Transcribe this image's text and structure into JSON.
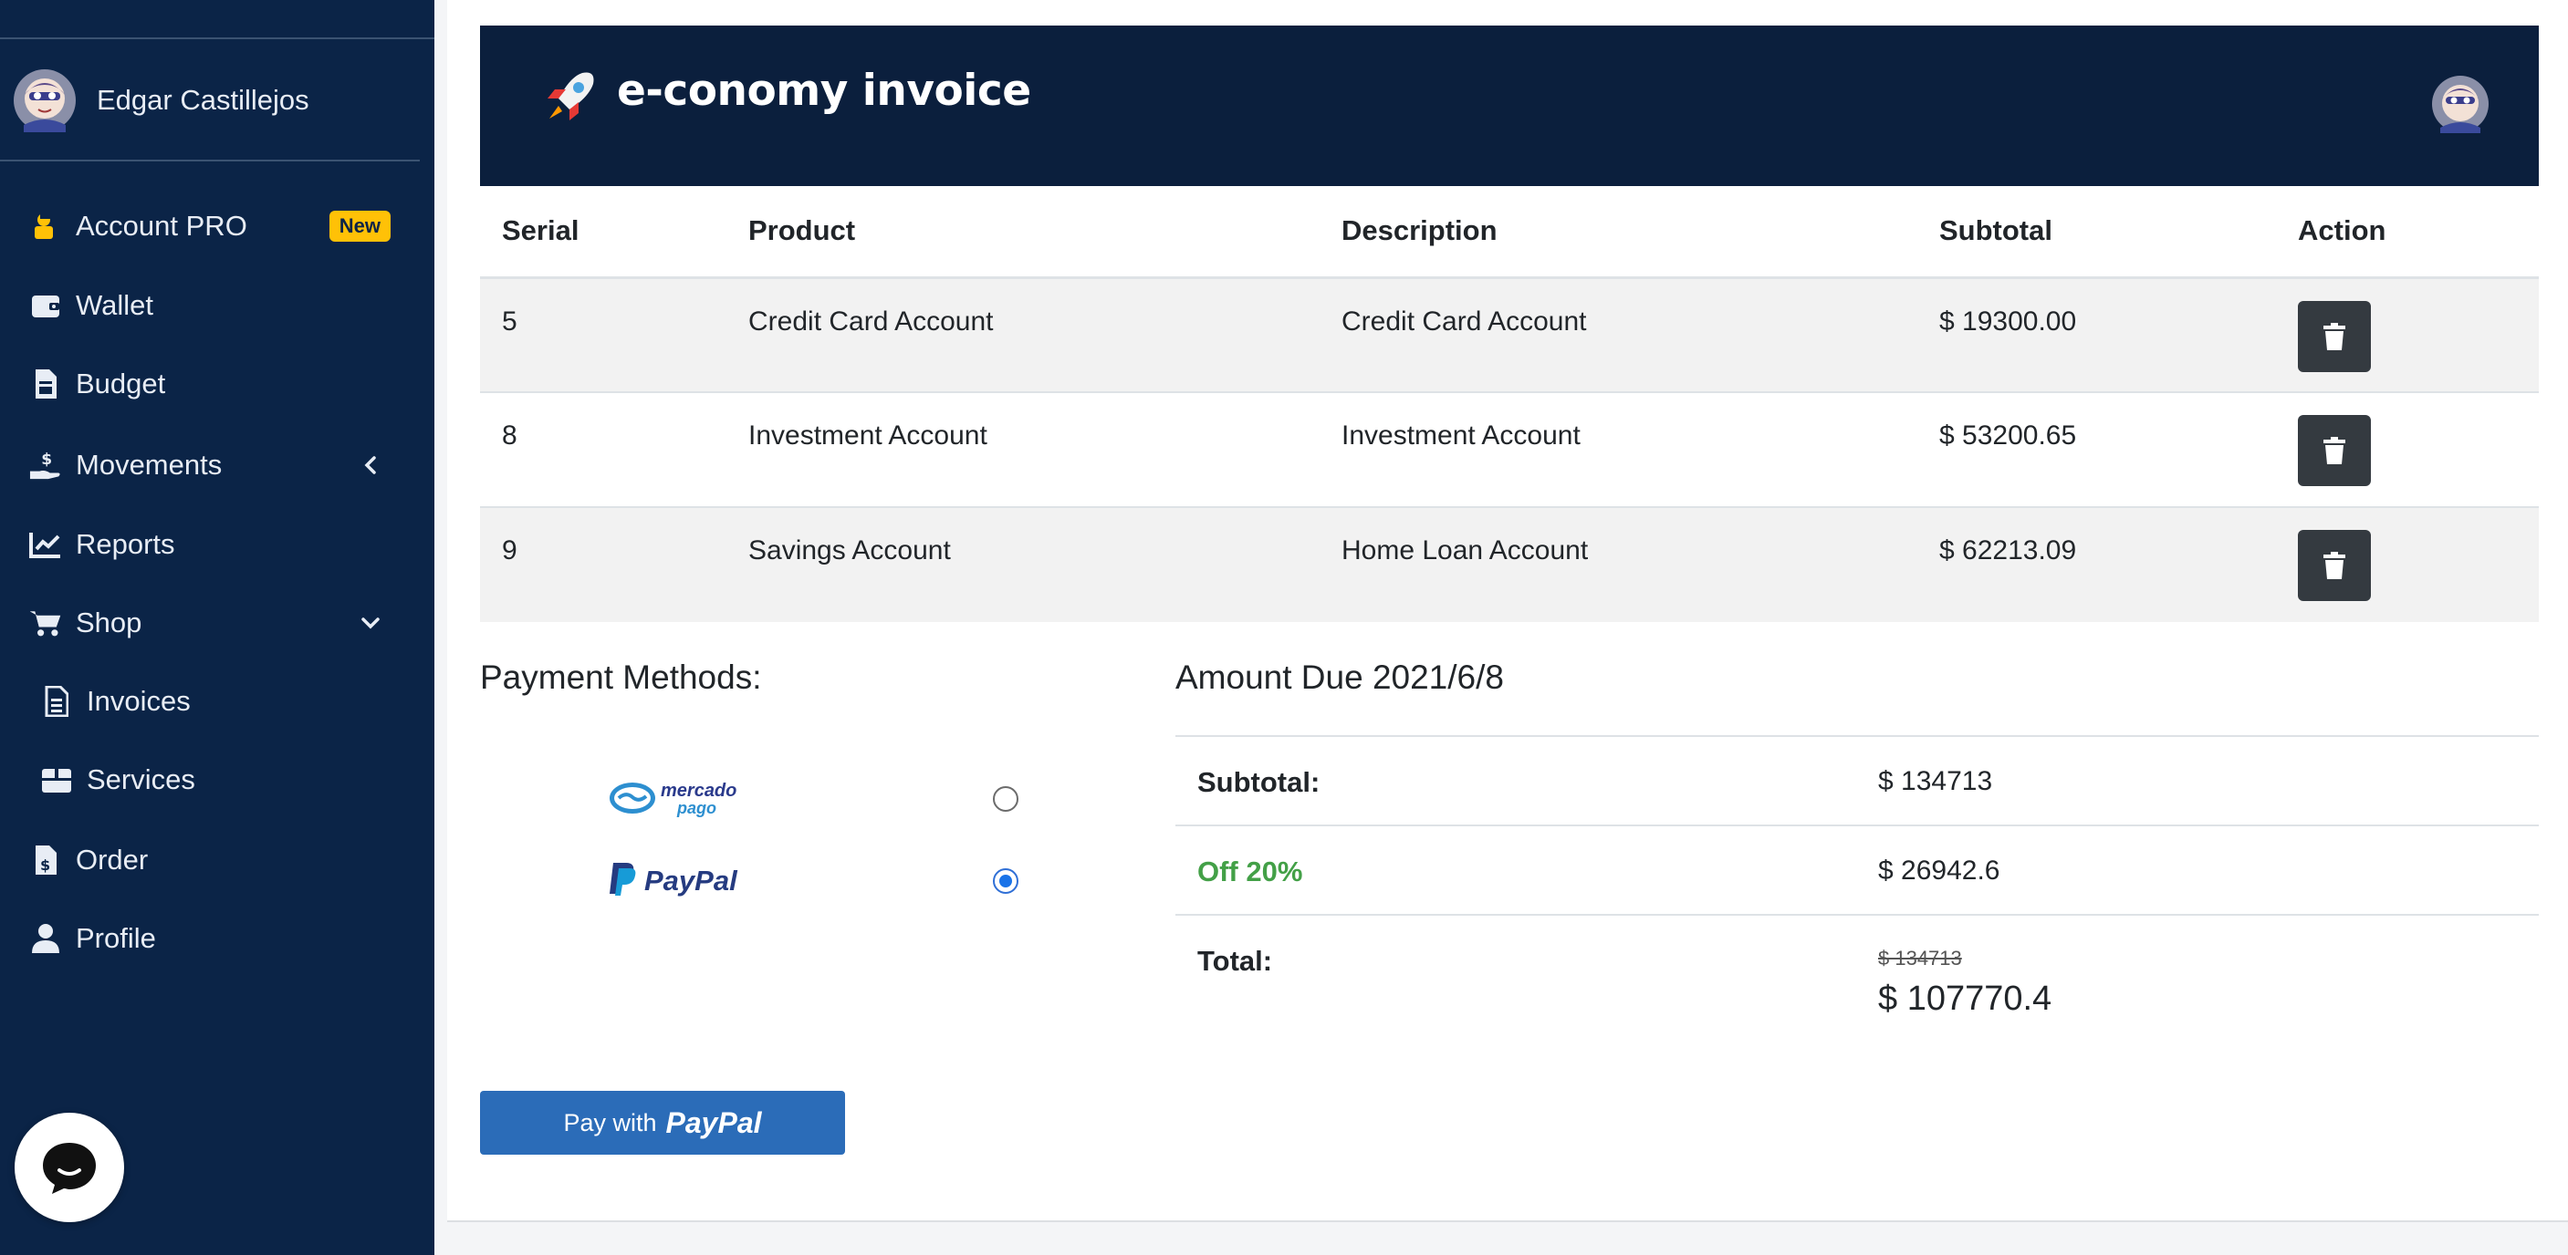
{
  "sidebar": {
    "user_name": "Edgar Castillejos",
    "items": [
      {
        "label": "Account PRO",
        "badge": "New",
        "icon": "user-tie-icon"
      },
      {
        "label": "Wallet",
        "icon": "wallet-icon"
      },
      {
        "label": "Budget",
        "icon": "file-invoice-icon"
      },
      {
        "label": "Movements",
        "icon": "hand-holding-dollar-icon",
        "caret": "chevron-left"
      },
      {
        "label": "Reports",
        "icon": "chart-line-icon"
      },
      {
        "label": "Shop",
        "icon": "cart-icon",
        "caret": "chevron-down"
      },
      {
        "label": "Invoices",
        "icon": "file-icon"
      },
      {
        "label": "Services",
        "icon": "box-icon"
      },
      {
        "label": "Order",
        "icon": "file-dollar-icon"
      },
      {
        "label": "Profile",
        "icon": "user-icon"
      }
    ]
  },
  "header": {
    "title": "e-conomy invoice"
  },
  "table": {
    "columns": [
      "Serial",
      "Product",
      "Description",
      "Subtotal",
      "Action"
    ],
    "rows": [
      {
        "serial": "5",
        "product": "Credit Card Account",
        "description": "Credit Card Account",
        "subtotal": "$ 19300.00"
      },
      {
        "serial": "8",
        "product": "Investment Account",
        "description": "Investment Account",
        "subtotal": "$ 53200.65"
      },
      {
        "serial": "9",
        "product": "Savings Account",
        "description": "Home Loan Account",
        "subtotal": "$ 62213.09"
      }
    ]
  },
  "payment": {
    "title": "Payment Methods:",
    "methods": [
      {
        "name": "mercado pago",
        "line1": "mercado",
        "line2": "pago",
        "selected": false
      },
      {
        "name": "PayPal",
        "selected": true
      }
    ],
    "button": {
      "pay_label": "Pay with",
      "brand": "PayPal"
    }
  },
  "due": {
    "title": "Amount Due 2021/6/8",
    "subtotal_label": "Subtotal:",
    "subtotal_value": "$ 134713",
    "off_label": "Off 20%",
    "off_value": "$ 26942.6",
    "total_label": "Total:",
    "total_original": "$ 134713",
    "total_value": "$ 107770.4"
  },
  "colors": {
    "sidebar": "#0b2447",
    "header": "#0b1f3d",
    "badge": "#ffc107",
    "discount": "#43a047",
    "paypal_button": "#2b6cb8"
  }
}
